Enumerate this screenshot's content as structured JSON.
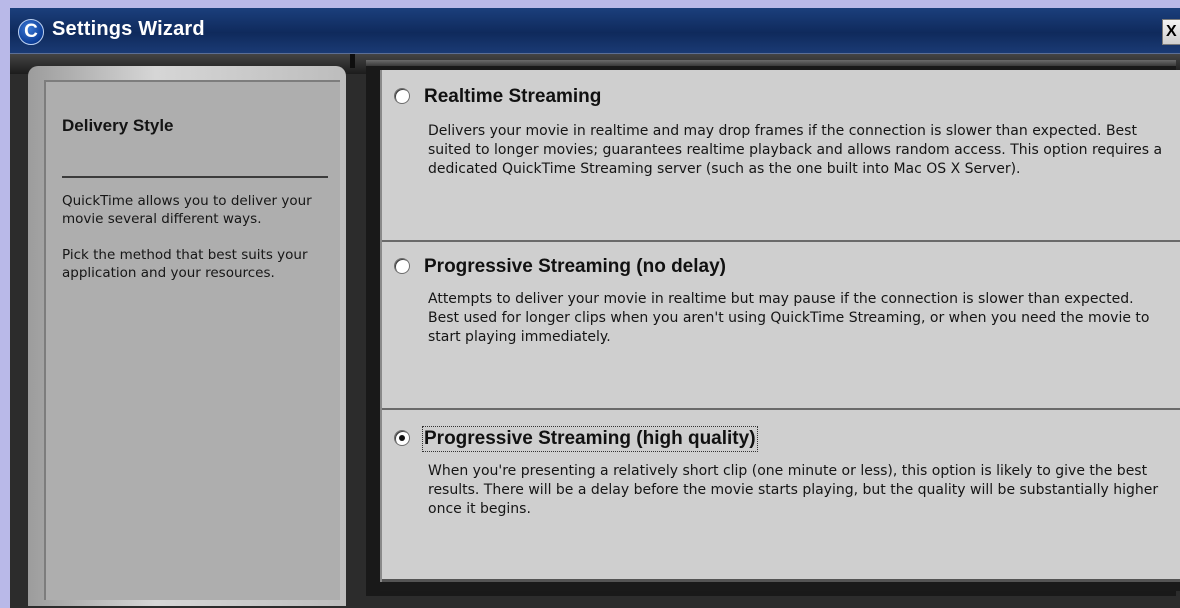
{
  "window": {
    "title": "Settings Wizard",
    "app_icon_glyph": "C",
    "close_glyph": "X"
  },
  "left_panel": {
    "heading": "Delivery Style",
    "paragraph1": "QuickTime allows you to deliver your movie several different ways.",
    "paragraph2": "Pick the method that best suits your application and your resources."
  },
  "options": [
    {
      "title": "Realtime Streaming",
      "selected": false,
      "description": "Delivers your movie in realtime and may drop frames if the connection is slower than expected.  Best suited to longer movies; guarantees realtime playback and allows random access. This option requires a dedicated QuickTime Streaming server (such as the one built into Mac OS X Server)."
    },
    {
      "title": "Progressive Streaming (no delay)",
      "selected": false,
      "description": "Attempts to deliver your movie in realtime but may pause if the connection is slower than expected.  Best used for longer clips when you aren't using QuickTime Streaming, or when you need the movie to start playing immediately."
    },
    {
      "title": "Progressive Streaming (high quality)",
      "selected": true,
      "description": "When you're presenting a relatively short clip (one minute or less), this option is likely to give the best results.  There will be a delay before the movie starts playing, but the quality will be substantially higher once it begins."
    }
  ],
  "colors": {
    "titlebar": "#0f2a5c",
    "panel_bg": "#cfcfcf",
    "left_panel_bg": "#aeaeae",
    "desktop_bg": "#b9b9e8"
  }
}
